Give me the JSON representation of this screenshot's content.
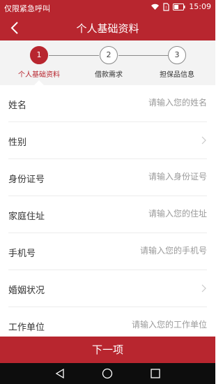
{
  "status_bar": {
    "carrier": "仅限紧急呼叫",
    "time": "15:09",
    "icons": [
      "wifi-icon",
      "sim-icon",
      "battery-icon"
    ]
  },
  "title_bar": {
    "title": "个人基础资料",
    "back_icon": "back-chevron-icon"
  },
  "stepper": {
    "steps": [
      {
        "number": "1",
        "label": "个人基础资料",
        "active": true
      },
      {
        "number": "2",
        "label": "借款需求",
        "active": false
      },
      {
        "number": "3",
        "label": "担保品信息",
        "active": false
      }
    ]
  },
  "form": {
    "fields": [
      {
        "label": "姓名",
        "placeholder": "请输入您的姓名"
      },
      {
        "label": "性别",
        "type": "select"
      },
      {
        "label": "身份证号",
        "placeholder": "请输入身份证号"
      },
      {
        "label": "家庭住址",
        "placeholder": "请输入您的住址"
      },
      {
        "label": "手机号",
        "placeholder": "请输入您的手机号"
      },
      {
        "label": "婚姻状况",
        "type": "select"
      },
      {
        "label": "工作单位",
        "placeholder": "请输入您的工作单位"
      }
    ]
  },
  "next_button": {
    "label": "下一项"
  },
  "colors": {
    "accent": "#b8262f",
    "stepper_bg": "#f3f3f3",
    "navbar_bg": "#0d0d0d"
  }
}
